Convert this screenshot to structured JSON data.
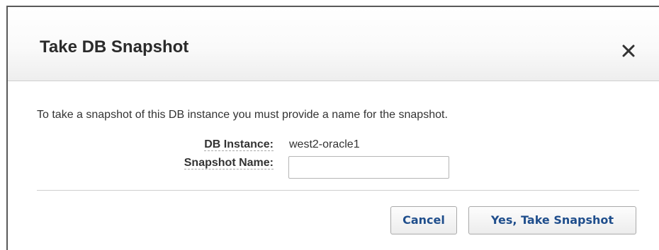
{
  "dialog": {
    "title": "Take DB Snapshot",
    "close_icon": "close-icon",
    "intro": "To take a snapshot of this DB instance you must provide a name for the snapshot.",
    "fields": {
      "db_instance_label": "DB Instance:",
      "db_instance_value": "west2-oracle1",
      "snapshot_name_label": "Snapshot Name:",
      "snapshot_name_value": ""
    },
    "buttons": {
      "cancel": "Cancel",
      "confirm": "Yes, Take Snapshot"
    },
    "colors": {
      "button_text": "#1f4e8c",
      "title_text": "#2b2b2b"
    }
  }
}
